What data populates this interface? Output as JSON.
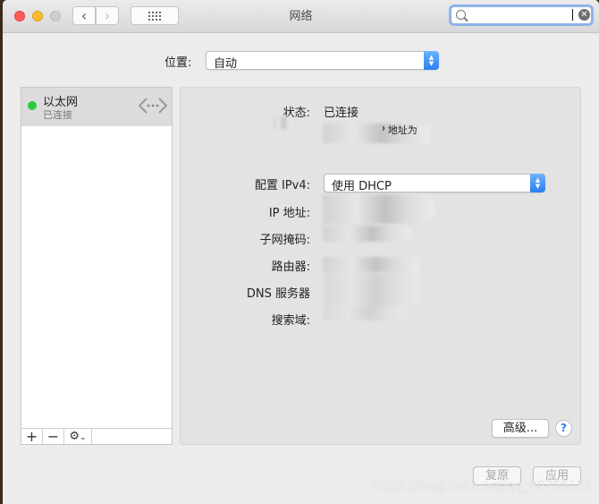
{
  "window": {
    "title": "网络"
  },
  "toolbar": {
    "back_icon": "chevron-left-icon",
    "forward_icon": "chevron-right-icon",
    "grid_icon": "show-all-grid-icon"
  },
  "search": {
    "value": "",
    "placeholder": ""
  },
  "location": {
    "label": "位置:",
    "value": "自动"
  },
  "sidebar": {
    "items": [
      {
        "name": "以太网",
        "status": "已连接",
        "status_color": "#2ac840",
        "icon": "ethernet-icon"
      }
    ],
    "tools": {
      "add": "+",
      "remove": "−",
      "gear": "⚙"
    }
  },
  "details": {
    "status_label": "状态:",
    "status_value": "已连接",
    "status_desc": "已连接，其 IP 地址为",
    "ipv4_label": "配置 IPv4:",
    "ipv4_value": "使用 DHCP",
    "ip_label": "IP 地址:",
    "subnet_label": "子网掩码:",
    "router_label": "路由器:",
    "dns_label": "DNS 服务器",
    "search_domain_label": "搜索域:",
    "advanced_button": "高级...",
    "help_button": "?"
  },
  "footer": {
    "revert": "复原",
    "apply": "应用"
  },
  "watermark": "https://blog.csdn.net/qq_40755155"
}
